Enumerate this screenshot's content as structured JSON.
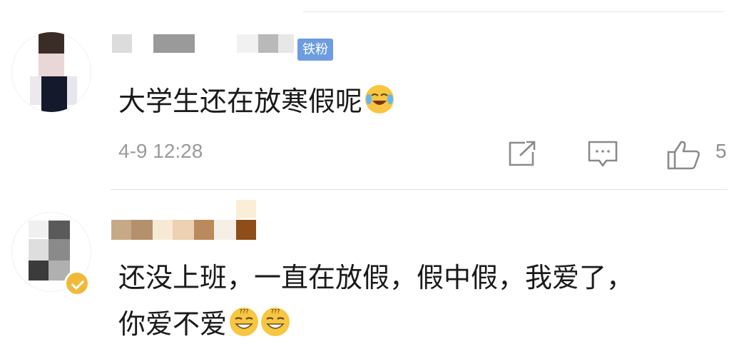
{
  "comments": [
    {
      "badge": "铁粉",
      "text": "大学生还在放寒假呢",
      "emoji": "crying-laughing-emoji",
      "time": "4-9 12:28",
      "likes": "5"
    },
    {
      "line1": "还没上班，一直在放假，假中假，我爱了，",
      "line2": "你爱不爱",
      "emoji": "dizzy-grin-emoji",
      "verified": true
    }
  ],
  "icons": {
    "share": "share-icon",
    "reply": "reply-icon",
    "like": "thumbs-up-icon"
  },
  "colors": {
    "badge": "#6d9cdf",
    "verified": "#f1b93a",
    "muted": "#9a9a9a"
  }
}
